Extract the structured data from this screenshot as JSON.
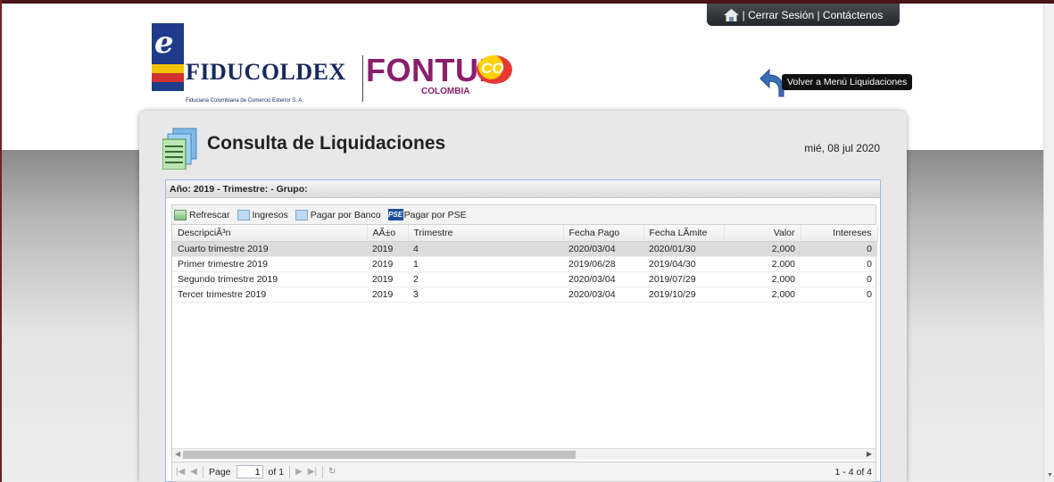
{
  "header": {
    "session_links": "| Cerrar Sesión | Contáctenos",
    "back_button": "Volver a Menú Liquidaciones"
  },
  "logos": {
    "fiducoldex_name": "FIDUCOLDEX",
    "fiducoldex_tagline": "Fiduciaria Colombiana de Comercio Exterior S. A.",
    "fontur_name": "FONTUR",
    "fontur_sub": "COLOMBIA",
    "co_badge": "CO"
  },
  "page": {
    "title": "Consulta de Liquidaciones",
    "date": "mié, 08 jul 2020"
  },
  "grid": {
    "filter_header": "Año: 2019 - Trimestre: - Grupo:",
    "toolbar": {
      "refresh": "Refrescar",
      "income": "Ingresos",
      "pay_bank": "Pagar por Banco",
      "pse_badge": "PSE",
      "pay_pse": "Pagar por PSE"
    },
    "columns": [
      "DescripciÃ³n",
      "AÃ±o",
      "Trimestre",
      "Fecha Pago",
      "Fecha LÃmite",
      "Valor",
      "Intereses"
    ],
    "rows": [
      {
        "desc": "Cuarto trimestre 2019",
        "year": "2019",
        "quarter": "4",
        "pay_date": "2020/03/04",
        "limit_date": "2020/01/30",
        "value": "2,000",
        "interest": "0"
      },
      {
        "desc": "Primer trimestre 2019",
        "year": "2019",
        "quarter": "1",
        "pay_date": "2019/06/28",
        "limit_date": "2019/04/30",
        "value": "2,000",
        "interest": "0"
      },
      {
        "desc": "Segundo trimestre 2019",
        "year": "2019",
        "quarter": "2",
        "pay_date": "2020/03/04",
        "limit_date": "2019/07/29",
        "value": "2,000",
        "interest": "0"
      },
      {
        "desc": "Tercer trimestre 2019",
        "year": "2019",
        "quarter": "3",
        "pay_date": "2020/03/04",
        "limit_date": "2019/10/29",
        "value": "2,000",
        "interest": "0"
      }
    ],
    "selected_row": 0,
    "pager": {
      "page_label": "Page",
      "page_value": "1",
      "of_label": "of 1",
      "info": "1 - 4 of 4"
    }
  },
  "colors": {
    "top_border": "#4a1418",
    "session_bar": "#2e3237",
    "fiducoldex_blue": "#17285e",
    "fontur_purple": "#8a1f6b",
    "grid_border": "#99bbe8"
  }
}
